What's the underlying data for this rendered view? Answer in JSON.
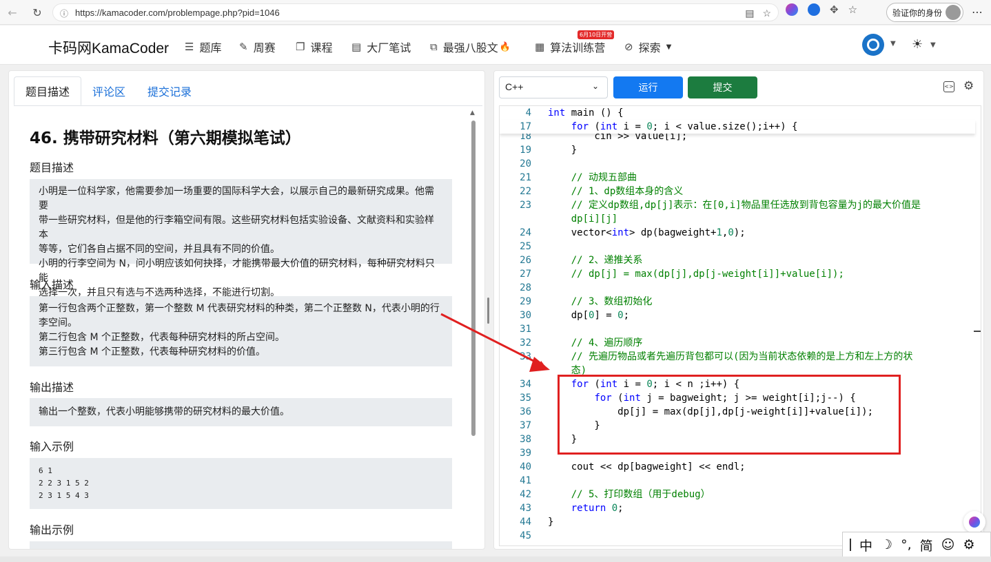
{
  "browser": {
    "url": "https://kamacoder.com/problempage.php?pid=1046",
    "verify_label": "验证你的身份"
  },
  "header": {
    "logo": "卡码网KamaCoder",
    "nav": [
      {
        "label": "题库",
        "icon": "list-icon"
      },
      {
        "label": "周赛",
        "icon": "pencil-icon"
      },
      {
        "label": "课程",
        "icon": "book-icon"
      },
      {
        "label": "大厂笔试",
        "icon": "document-icon"
      },
      {
        "label": "最强八股文",
        "icon": "code-doc-icon"
      },
      {
        "label": "算法训练营",
        "icon": "calendar-icon"
      },
      {
        "label": "探索",
        "icon": "compass-icon"
      }
    ],
    "camp_badge": "6月10日开营",
    "fire": "🔥"
  },
  "left": {
    "tabs": [
      "题目描述",
      "评论区",
      "提交记录"
    ],
    "title": "46. 携带研究材料（第六期模拟笔试）",
    "sections": {
      "desc_head": "题目描述",
      "desc_lines": [
        "小明是一位科学家，他需要参加一场重要的国际科学大会，以展示自己的最新研究成果。他需要",
        "带一些研究材料，但是他的行李箱空间有限。这些研究材料包括实验设备、文献资料和实验样本",
        "等等，它们各自占据不同的空间，并且具有不同的价值。",
        "小明的行李空间为 N，问小明应该如何抉择，才能携带最大价值的研究材料，每种研究材料只能",
        "选择一次，并且只有选与不选两种选择，不能进行切割。"
      ],
      "input_head": "输入描述",
      "input_lines": [
        "第一行包含两个正整数，第一个整数 M 代表研究材料的种类，第二个正整数 N，代表小明的行",
        "李空间。",
        "第二行包含 M 个正整数，代表每种研究材料的所占空间。",
        "第三行包含 M 个正整数，代表每种研究材料的价值。"
      ],
      "output_head": "输出描述",
      "output_lines": [
        "输出一个整数，代表小明能够携带的研究材料的最大价值。"
      ],
      "input_example_head": "输入示例",
      "input_example": "6 1\n2 2 3 1 5 2\n2 3 1 5 4 3",
      "output_example_head": "输出示例"
    }
  },
  "right": {
    "language": "C++",
    "run_label": "运行",
    "submit_label": "提交",
    "sticky": [
      {
        "ln": "4",
        "html": "<span class=\"kw\">int</span> main () {"
      },
      {
        "ln": "17",
        "html": "    <span class=\"kw\">for</span> (<span class=\"kw\">int</span> i = <span class=\"num\">0</span>; i &lt; value.size();i++) {"
      }
    ],
    "lines": [
      {
        "ln": "18",
        "html": "        cin >> value[i];"
      },
      {
        "ln": "19",
        "html": "    }"
      },
      {
        "ln": "20",
        "html": ""
      },
      {
        "ln": "21",
        "html": "    <span class=\"cm\">// 动规五部曲</span>"
      },
      {
        "ln": "22",
        "html": "    <span class=\"cm\">// 1、dp数组本身的含义</span>"
      },
      {
        "ln": "23",
        "html": "    <span class=\"cm\">// 定义dp数组,dp[j]表示：在[0,i]物品里任选放到背包容量为j的最大价值是</span>"
      },
      {
        "ln": "",
        "html": "    <span class=\"cm\">dp[i][j]</span>"
      },
      {
        "ln": "24",
        "html": "    vector&lt;<span class=\"kw\">int</span>&gt; dp(bagweight+<span class=\"num\">1</span>,<span class=\"num\">0</span>);"
      },
      {
        "ln": "25",
        "html": ""
      },
      {
        "ln": "26",
        "html": "    <span class=\"cm\">// 2、递推关系</span>"
      },
      {
        "ln": "27",
        "html": "    <span class=\"cm\">// dp[j] = max(dp[j],dp[j-weight[i]]+value[i]);</span>"
      },
      {
        "ln": "28",
        "html": ""
      },
      {
        "ln": "29",
        "html": "    <span class=\"cm\">// 3、数组初始化</span>"
      },
      {
        "ln": "30",
        "html": "    dp[<span class=\"num\">0</span>] = <span class=\"num\">0</span>;"
      },
      {
        "ln": "31",
        "html": ""
      },
      {
        "ln": "32",
        "html": "    <span class=\"cm\">// 4、遍历顺序</span>"
      },
      {
        "ln": "33",
        "html": "    <span class=\"cm\">// 先遍历物品或者先遍历背包都可以(因为当前状态依赖的是上方和左上方的状</span>"
      },
      {
        "ln": "",
        "html": "    <span class=\"cm\">态)</span>"
      },
      {
        "ln": "34",
        "html": "    <span class=\"kw\">for</span> (<span class=\"kw\">int</span> i = <span class=\"num\">0</span>; i &lt; n ;i++) {"
      },
      {
        "ln": "35",
        "html": "        <span class=\"kw\">for</span> (<span class=\"kw\">int</span> j = bagweight; j &gt;= weight[i];j--) {"
      },
      {
        "ln": "36",
        "html": "            dp[j] = max(dp[j],dp[j-weight[i]]+value[i]);"
      },
      {
        "ln": "37",
        "html": "        }"
      },
      {
        "ln": "38",
        "html": "    }"
      },
      {
        "ln": "39",
        "html": ""
      },
      {
        "ln": "40",
        "html": "    cout &lt;&lt; dp[bagweight] &lt;&lt; endl;"
      },
      {
        "ln": "41",
        "html": ""
      },
      {
        "ln": "42",
        "html": "    <span class=\"cm\">// 5、打印数组（用于debug）</span>"
      },
      {
        "ln": "43",
        "html": "    <span class=\"kw\">return</span> <span class=\"num\">0</span>;"
      },
      {
        "ln": "44",
        "html": "}"
      },
      {
        "ln": "45",
        "html": ""
      }
    ]
  },
  "ime": {
    "items": [
      "中",
      "☽",
      "°,",
      "简",
      "☺",
      "⚙"
    ]
  }
}
